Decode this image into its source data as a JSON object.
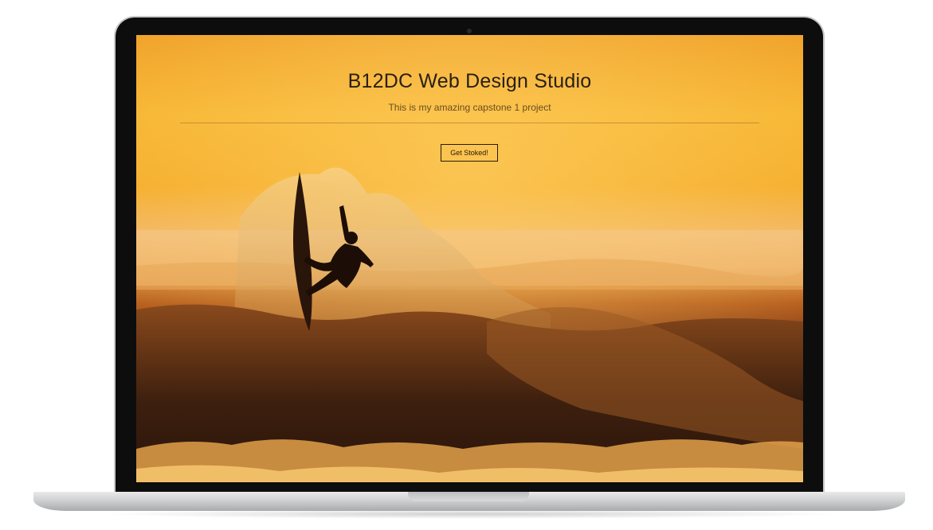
{
  "hero": {
    "title": "B12DC Web Design Studio",
    "subtitle": "This is my amazing capstone 1 project",
    "cta_label": "Get Stoked!"
  },
  "scene": {
    "image_subject": "surfer-silhouette-on-wave-at-sunset"
  },
  "colors": {
    "sky": "#f7b632",
    "wave_dark": "#4a2612",
    "title_text": "#2a2015",
    "laptop_bezel": "#0d0d0d",
    "laptop_body": "#cfd0d2"
  }
}
